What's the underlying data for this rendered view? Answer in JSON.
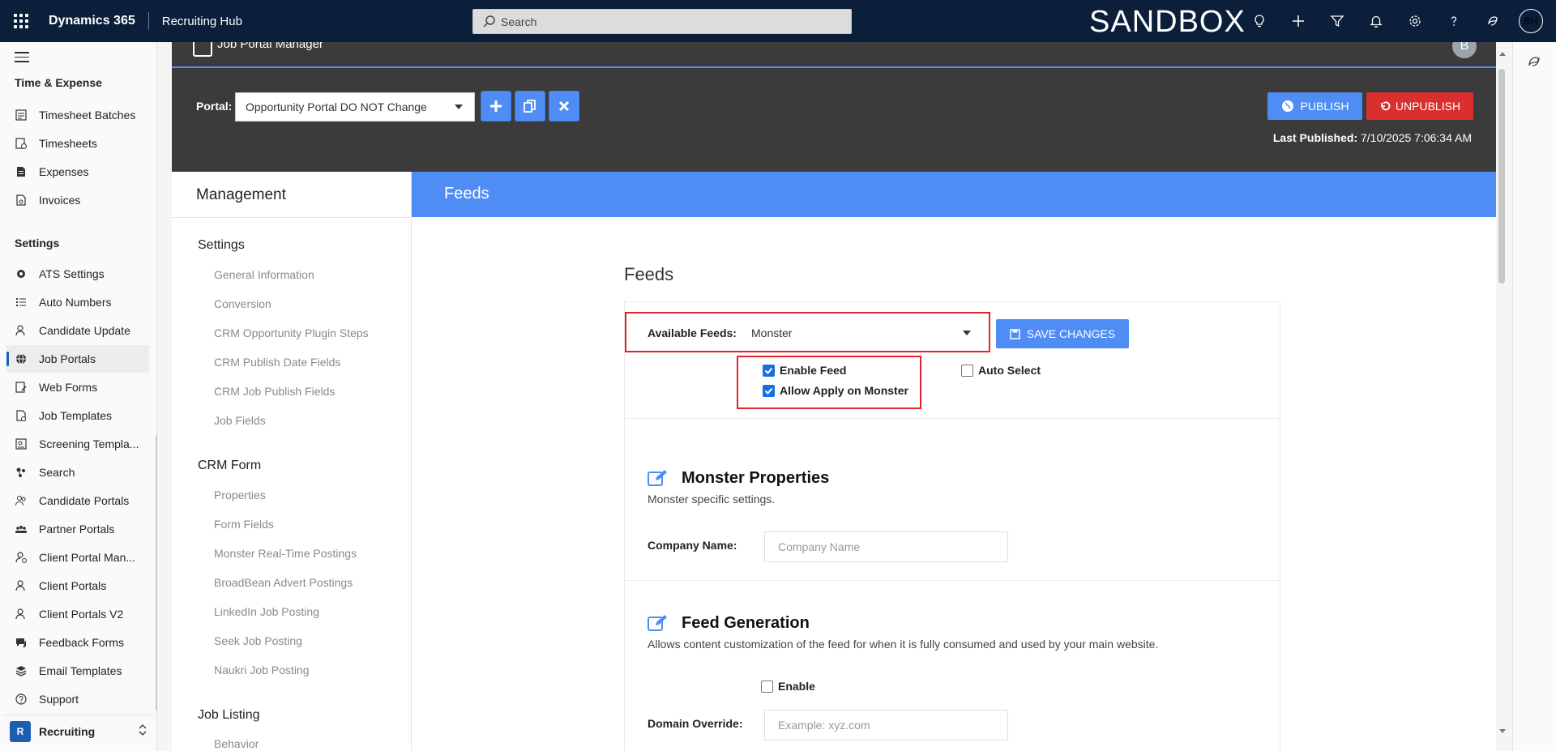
{
  "topbar": {
    "brand": "Dynamics 365",
    "app": "Recruiting Hub",
    "search_placeholder": "Search",
    "environment": "SANDBOX",
    "user_initials": "BH"
  },
  "leftnav": {
    "section_time": "Time & Expense",
    "time_items": [
      {
        "label": "Timesheet Batches",
        "icon": "timesheet-batches-icon"
      },
      {
        "label": "Timesheets",
        "icon": "timesheets-icon"
      },
      {
        "label": "Expenses",
        "icon": "expenses-icon"
      },
      {
        "label": "Invoices",
        "icon": "invoices-icon"
      }
    ],
    "section_settings": "Settings",
    "settings_items": [
      {
        "label": "ATS Settings",
        "icon": "gear-icon"
      },
      {
        "label": "Auto Numbers",
        "icon": "numbered-list-icon"
      },
      {
        "label": "Candidate Update",
        "icon": "person-icon"
      },
      {
        "label": "Job Portals",
        "icon": "globe-icon",
        "active": true
      },
      {
        "label": "Web Forms",
        "icon": "form-edit-icon"
      },
      {
        "label": "Job Templates",
        "icon": "template-icon"
      },
      {
        "label": "Screening Templa...",
        "icon": "screening-icon"
      },
      {
        "label": "Search",
        "icon": "search-flow-icon"
      },
      {
        "label": "Candidate Portals",
        "icon": "people-icon"
      },
      {
        "label": "Partner Portals",
        "icon": "group-icon"
      },
      {
        "label": "Client Portal Man...",
        "icon": "person-gear-icon"
      },
      {
        "label": "Client Portals",
        "icon": "person-icon"
      },
      {
        "label": "Client Portals V2",
        "icon": "person-icon"
      },
      {
        "label": "Feedback Forms",
        "icon": "feedback-icon"
      },
      {
        "label": "Email Templates",
        "icon": "layers-icon"
      },
      {
        "label": "Support",
        "icon": "help-circle-icon"
      }
    ],
    "area": {
      "badge": "R",
      "label": "Recruiting"
    }
  },
  "header": {
    "title": "Job Portal Manager",
    "circle_initial": "B",
    "portal_label": "Portal:",
    "portal_value": "Opportunity Portal DO NOT Change",
    "publish_label": "PUBLISH",
    "unpublish_label": "UNPUBLISH",
    "last_published_label": "Last Published:",
    "last_published_value": "7/10/2025 7:06:34 AM"
  },
  "management": {
    "title": "Management",
    "sections": [
      {
        "title": "Settings",
        "links": [
          "General Information",
          "Conversion",
          "CRM Opportunity Plugin Steps",
          "CRM Publish Date Fields",
          "CRM Job Publish Fields",
          "Job Fields"
        ]
      },
      {
        "title": "CRM Form",
        "links": [
          "Properties",
          "Form Fields",
          "Monster Real-Time Postings",
          "BroadBean Advert Postings",
          "LinkedIn Job Posting",
          "Seek Job Posting",
          "Naukri Job Posting"
        ]
      },
      {
        "title": "Job Listing",
        "links": [
          "Behavior"
        ]
      }
    ]
  },
  "feeds": {
    "banner": "Feeds",
    "heading": "Feeds",
    "available_label": "Available Feeds:",
    "available_value": "Monster",
    "save_label": "SAVE CHANGES",
    "enable_feed_label": "Enable Feed",
    "enable_feed_checked": true,
    "allow_apply_label": "Allow Apply on Monster",
    "allow_apply_checked": true,
    "auto_select_label": "Auto Select",
    "auto_select_checked": false,
    "monster_title": "Monster Properties",
    "monster_sub": "Monster specific settings.",
    "company_label": "Company Name:",
    "company_placeholder": "Company Name",
    "feedgen_title": "Feed Generation",
    "feedgen_sub": "Allows content customization of the feed for when it is fully consumed and used by your main website.",
    "enable_label": "Enable",
    "enable_checked": false,
    "domain_label": "Domain Override:",
    "domain_placeholder": "Example: xyz.com"
  },
  "colors": {
    "topbar": "#0b1f3a",
    "accent_blue": "#4f8df5",
    "danger_red": "#d9302f",
    "highlight_red": "#e0242a",
    "dark_header": "#3b3b3b"
  }
}
